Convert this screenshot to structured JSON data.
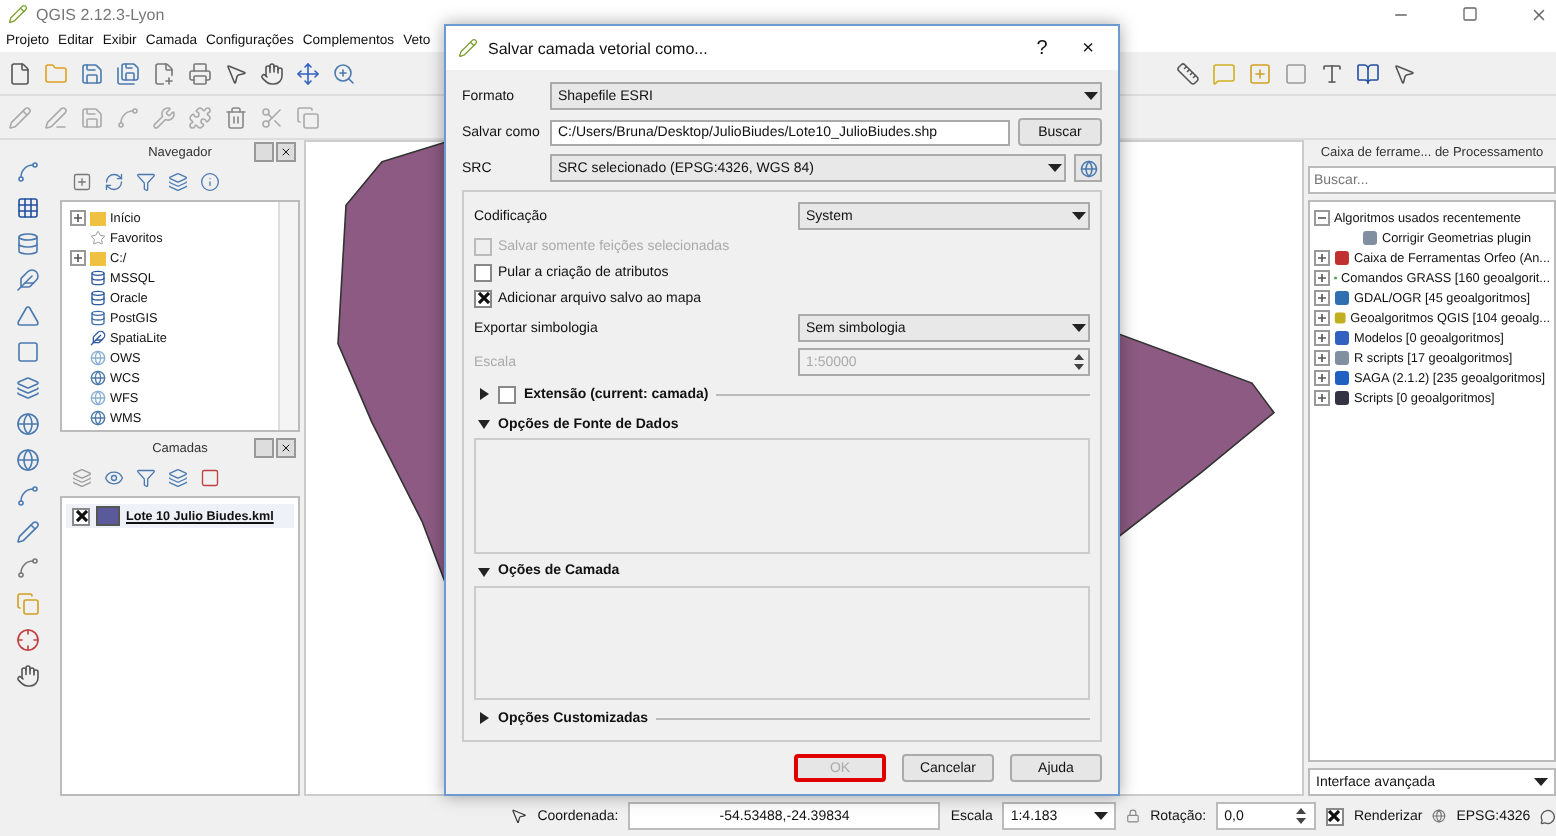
{
  "window": {
    "title": "QGIS 2.12.3-Lyon"
  },
  "menu": [
    "Projeto",
    "Editar",
    "Exibir",
    "Camada",
    "Configurações",
    "Complementos",
    "Veto"
  ],
  "navigator": {
    "title": "Navegador",
    "items": [
      {
        "label": "Início",
        "kind": "folder",
        "expanded": false
      },
      {
        "label": "Favoritos",
        "kind": "favorites"
      },
      {
        "label": "C:/",
        "kind": "folder",
        "expanded": false
      },
      {
        "label": "MSSQL",
        "kind": "mssql"
      },
      {
        "label": "Oracle",
        "kind": "oracle"
      },
      {
        "label": "PostGIS",
        "kind": "postgis"
      },
      {
        "label": "SpatiaLite",
        "kind": "spatialite"
      },
      {
        "label": "OWS",
        "kind": "ows"
      },
      {
        "label": "WCS",
        "kind": "wcs"
      },
      {
        "label": "WFS",
        "kind": "wfs"
      },
      {
        "label": "WMS",
        "kind": "wms"
      }
    ]
  },
  "layers": {
    "title": "Camadas",
    "items": [
      {
        "name": "Lote 10 Julio Biudes.kml",
        "visible": true,
        "color": "#5a5a9a",
        "selected": true
      }
    ]
  },
  "processing": {
    "title": "Caixa de ferrame... de Processamento",
    "search": {
      "placeholder": "Buscar..."
    },
    "items": [
      {
        "label": "Algoritmos usados recentemente",
        "expanded": true,
        "children": [
          {
            "label": "Corrigir Geometrias plugin"
          }
        ]
      },
      {
        "label": "Caixa de Ferramentas Orfeo (An...",
        "expanded": false
      },
      {
        "label": "Comandos GRASS [160 geoalgorit...",
        "expanded": false
      },
      {
        "label": "GDAL/OGR [45 geoalgoritmos]",
        "expanded": false
      },
      {
        "label": "Geoalgoritmos QGIS [104 geoalg...",
        "expanded": false
      },
      {
        "label": "Modelos [0 geoalgoritmos]",
        "expanded": false
      },
      {
        "label": "R scripts [17 geoalgoritmos]",
        "expanded": false
      },
      {
        "label": "SAGA (2.1.2) [235 geoalgoritmos]",
        "expanded": false
      },
      {
        "label": "Scripts [0 geoalgoritmos]",
        "expanded": false
      }
    ],
    "mode": "Interface avançada"
  },
  "status_bar": {
    "coord_label": "Coordenada:",
    "coord": "-54.53488,-24.39834",
    "scale_label": "Escala",
    "scale": "1:4.183",
    "rotation_label": "Rotação:",
    "rotation": "0,0",
    "render": {
      "label": "Renderizar",
      "checked": true
    },
    "crs": "EPSG:4326"
  },
  "dialog": {
    "title": "Salvar camada vetorial como...",
    "help": "?",
    "close": "×",
    "format": {
      "label": "Formato",
      "value": "Shapefile ESRI"
    },
    "save_as": {
      "label": "Salvar como",
      "value": "C:/Users/Bruna/Desktop/JulioBiudes/Lote10_JulioBiudes.shp",
      "button": "Buscar"
    },
    "crs": {
      "label": "SRC",
      "value": "SRC selecionado (EPSG:4326, WGS 84)"
    },
    "encoding": {
      "label": "Codificação",
      "value": "System"
    },
    "options": [
      {
        "label": "Salvar somente feições selecionadas",
        "checked": false,
        "disabled": true
      },
      {
        "label": "Pular a criação de atributos",
        "checked": false,
        "disabled": false
      },
      {
        "label": "Adicionar arquivo salvo ao mapa",
        "checked": true,
        "disabled": false
      }
    ],
    "symbology": {
      "label": "Exportar simbologia",
      "value": "Sem simbologia"
    },
    "scale": {
      "label": "Escala",
      "value": "1:50000",
      "disabled": true
    },
    "sections": [
      {
        "label": "Extensão (current: camada)",
        "expanded": false,
        "checked": false
      },
      {
        "label": "Opções de Fonte de Dados",
        "expanded": true
      },
      {
        "label": "Oções de Camada",
        "expanded": true
      },
      {
        "label": "Opções Customizadas",
        "expanded": false
      }
    ],
    "buttons": [
      {
        "label": "OK",
        "disabled": true,
        "highlighted": true
      },
      {
        "label": "Cancelar",
        "disabled": false,
        "highlighted": false
      },
      {
        "label": "Ajuda",
        "disabled": false,
        "highlighted": false
      }
    ]
  }
}
